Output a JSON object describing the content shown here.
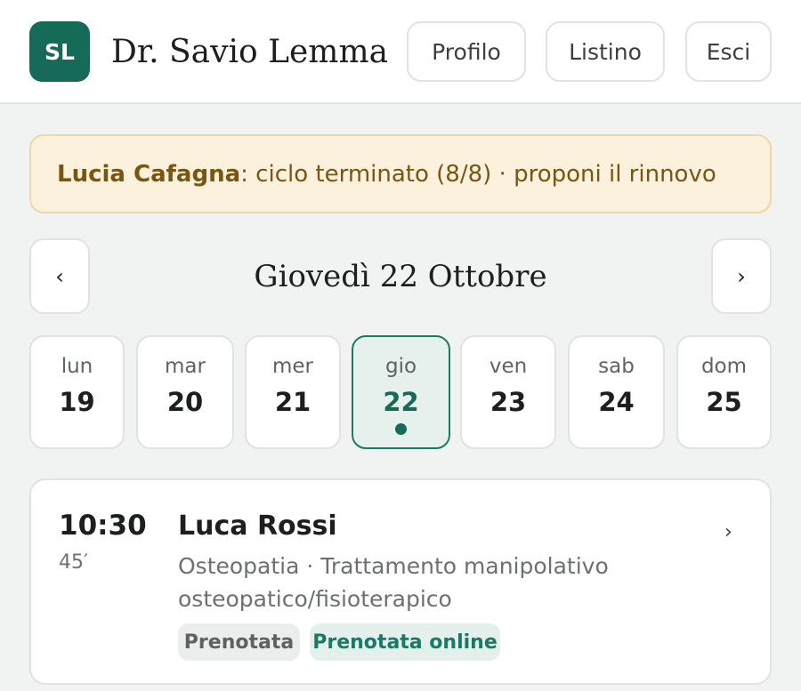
{
  "header": {
    "avatar_initials": "SL",
    "doctor_name": "Dr. Savio Lemma",
    "buttons": {
      "profile": "Profilo",
      "pricelist": "Listino",
      "logout": "Esci"
    }
  },
  "banner": {
    "patient": "Lucia Cafagna",
    "message": ": ciclo terminato (8/8) · proponi il rinnovo"
  },
  "date_nav": {
    "prev_icon": "‹",
    "next_icon": "›",
    "title": "Giovedì 22 Ottobre"
  },
  "week": [
    {
      "name": "lun",
      "num": "19",
      "selected": false
    },
    {
      "name": "mar",
      "num": "20",
      "selected": false
    },
    {
      "name": "mer",
      "num": "21",
      "selected": false
    },
    {
      "name": "gio",
      "num": "22",
      "selected": true,
      "has_appointments": true
    },
    {
      "name": "ven",
      "num": "23",
      "selected": false
    },
    {
      "name": "sab",
      "num": "24",
      "selected": false
    },
    {
      "name": "dom",
      "num": "25",
      "selected": false
    }
  ],
  "appointments": [
    {
      "time": "10:30",
      "duration": "45′",
      "patient": "Luca Rossi",
      "description": "Osteopatia · Trattamento manipolativo osteopatico/fisioterapico",
      "chevron_icon": "›",
      "tags": [
        "Prenotata",
        "Prenotata online"
      ]
    }
  ],
  "colors": {
    "brand": "#166b58",
    "banner_bg": "#fcf1dc",
    "banner_text": "#7a5512",
    "selected_day_bg": "#e6f1ee"
  }
}
